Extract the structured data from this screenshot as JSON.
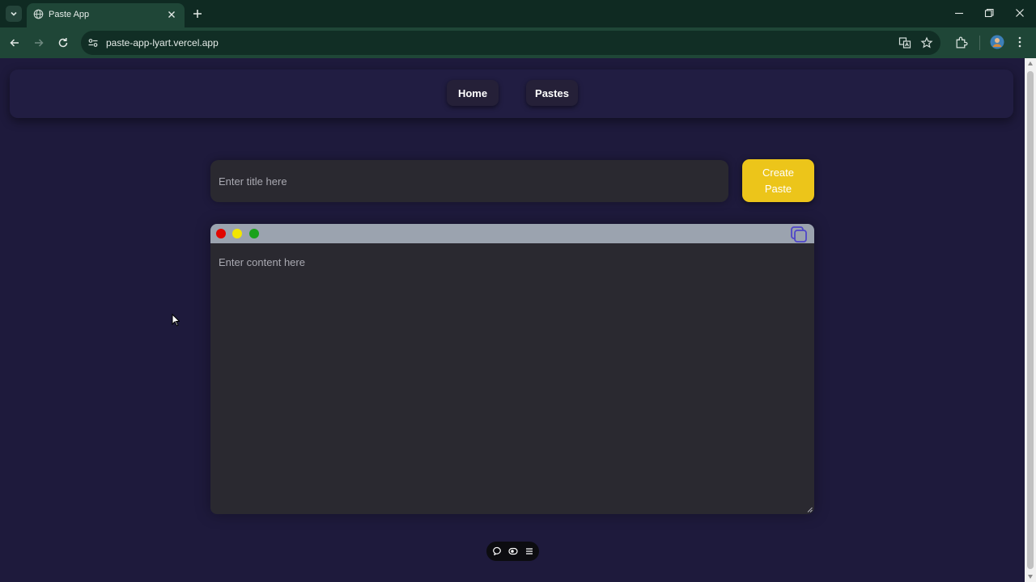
{
  "browser": {
    "tab_title": "Paste App",
    "url": "paste-app-lyart.vercel.app"
  },
  "nav": {
    "links": [
      {
        "label": "Home"
      },
      {
        "label": "Pastes"
      }
    ]
  },
  "form": {
    "title_placeholder": "Enter title here",
    "create_button_label": "Create\nPaste",
    "content_placeholder": "Enter content here"
  },
  "colors": {
    "page_background": "#1e1a3c",
    "accent_button": "#ecc51a",
    "editor_dots": [
      "#e10600",
      "#f2e600",
      "#1aa11a"
    ]
  },
  "icons": {
    "editor_copy": "copy-icon",
    "floating_toolbar": [
      "comment-icon",
      "eye-icon",
      "menu-icon"
    ]
  }
}
